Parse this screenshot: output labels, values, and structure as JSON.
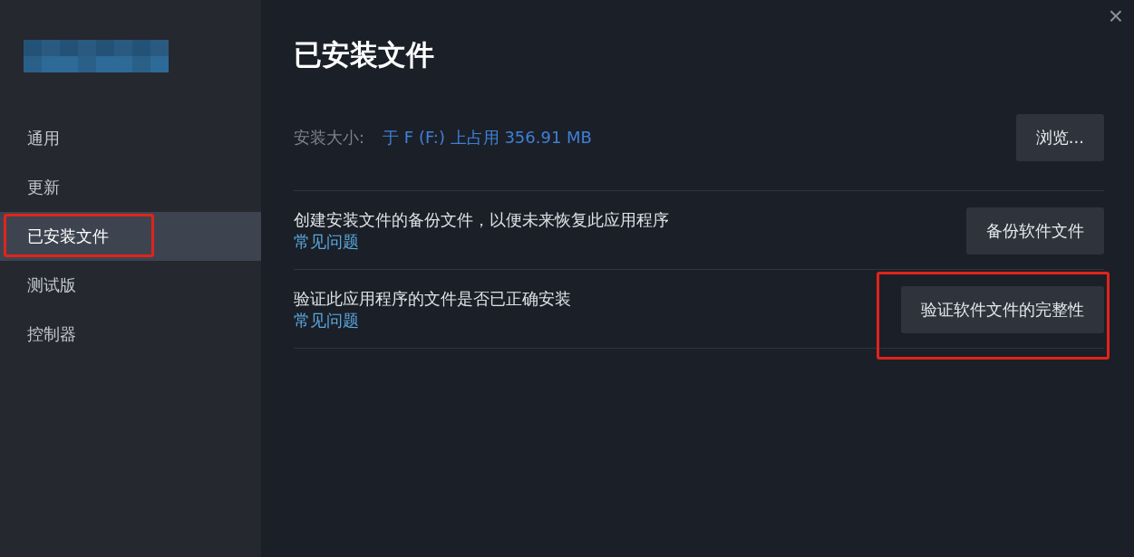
{
  "sidebar": {
    "items": [
      {
        "label": "通用",
        "selected": false,
        "highlighted": false
      },
      {
        "label": "更新",
        "selected": false,
        "highlighted": false
      },
      {
        "label": "已安装文件",
        "selected": true,
        "highlighted": true
      },
      {
        "label": "测试版",
        "selected": false,
        "highlighted": false
      },
      {
        "label": "控制器",
        "selected": false,
        "highlighted": false
      }
    ]
  },
  "close": "×",
  "title": "已安装文件",
  "install_size": {
    "label": "安装大小:",
    "value": "于 F (F:) 上占用 356.91 MB",
    "button": "浏览..."
  },
  "rows": [
    {
      "description": "创建安装文件的备份文件，以便未来恢复此应用程序",
      "link": "常见问题",
      "button": "备份软件文件",
      "highlighted": false
    },
    {
      "description": "验证此应用程序的文件是否已正确安装",
      "link": "常见问题",
      "button": "验证软件文件的完整性",
      "highlighted": true
    }
  ]
}
